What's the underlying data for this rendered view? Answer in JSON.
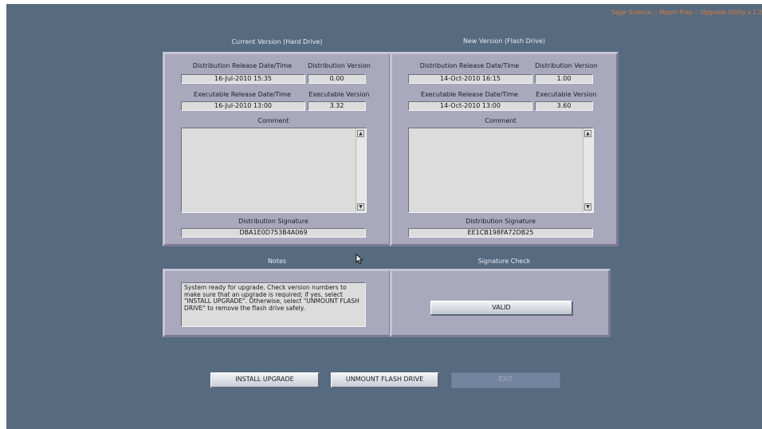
{
  "app_title": "Sage Science :: Pippin Prep :: Upgrade Utility v.1.2",
  "current": {
    "heading": "Current Version (Hard Drive)",
    "dist_date_label": "Distribution Release Date/Time",
    "dist_version_label": "Distribution Version",
    "dist_date": "16-Jul-2010  15:35",
    "dist_version": "0.00",
    "exe_date_label": "Executable Release Date/Time",
    "exe_version_label": "Executable Version",
    "exe_date": "16-Jul-2010  13:00",
    "exe_version": "3.32",
    "comment_label": "Comment",
    "comment": "",
    "signature_label": "Distribution Signature",
    "signature": "DBA1E0D753B4A069"
  },
  "new": {
    "heading": "New Version (Flash Drive)",
    "dist_date_label": "Distribution Release Date/Time",
    "dist_version_label": "Distribution Version",
    "dist_date": "14-Oct-2010  16:15",
    "dist_version": "1.00",
    "exe_date_label": "Executable Release Date/Time",
    "exe_version_label": "Executable Version",
    "exe_date": "14-Oct-2010  13:00",
    "exe_version": "3.60",
    "comment_label": "Comment",
    "comment": "",
    "signature_label": "Distribution Signature",
    "signature": "EE1CB198FA72DB25"
  },
  "notes": {
    "heading": "Notes",
    "text": "System ready for upgrade. Check version numbers to make sure that an upgrade is required; if yes, select \"INSTALL UPGRADE\". Otherwise, select \"UNMOUNT FLASH DRIVE\" to remove the flash drive safely."
  },
  "signature_check": {
    "heading": "Signature Check",
    "status": "VALID"
  },
  "buttons": {
    "install": "INSTALL UPGRADE",
    "unmount": "UNMOUNT FLASH DRIVE",
    "exit": "EXIT"
  },
  "icons": {
    "scroll_up": "scroll-up-arrow-icon",
    "scroll_down": "scroll-down-arrow-icon",
    "cursor": "mouse-pointer-icon"
  },
  "colors": {
    "background": "#566a80",
    "panel": "#a9a8bd",
    "title_accent": "#e07d35"
  }
}
